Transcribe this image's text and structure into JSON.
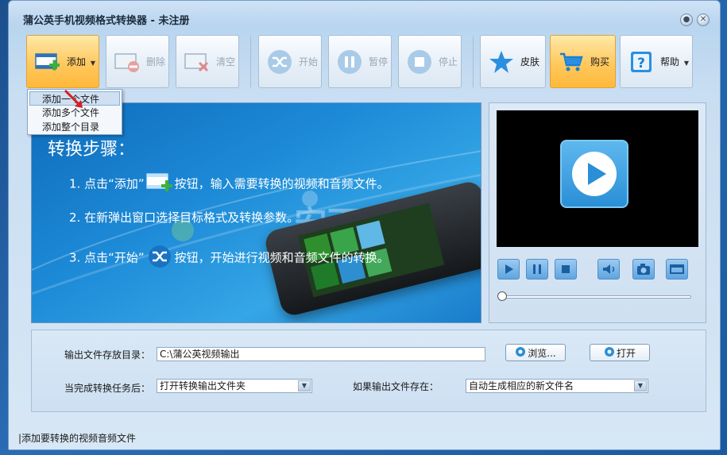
{
  "window": {
    "title": "蒲公英手机视频格式转换器 - 未注册",
    "min_glyph": "●",
    "close_glyph": "✕"
  },
  "toolbar": {
    "add_label": "添加",
    "delete_label": "删除",
    "clear_label": "清空",
    "start_label": "开始",
    "pause_label": "暂停",
    "stop_label": "停止",
    "skin_label": "皮肤",
    "buy_label": "购买",
    "help_label": "帮助"
  },
  "add_menu": {
    "items": [
      "添加一个文件",
      "添加多个文件",
      "添加整个目录"
    ]
  },
  "banner": {
    "title": "转换步骤：",
    "step1_a": "1. 点击“添加”",
    "step1_b": "按钮，输入需要转换的视频和音频文件。",
    "step2": "2. 在新弹出窗口选择目标格式及转换参数。",
    "step3_a": "3. 点击“开始”",
    "step3_b": "按钮，开始进行视频和音频文件的转换。",
    "watermark": "安下载"
  },
  "player": {
    "progress": 0
  },
  "settings": {
    "output_dir_label": "输出文件存放目录：",
    "output_dir_value": "C:\\蒲公英视频输出",
    "browse_label": "浏览...",
    "open_label": "打开",
    "after_done_label": "当完成转换任务后：",
    "after_done_value": "打开转换输出文件夹",
    "if_exists_label": "如果输出文件存在：",
    "if_exists_value": "自动生成相应的新文件名"
  },
  "status": {
    "text": "|添加要转换的视频音频文件"
  },
  "colors": {
    "accent_orange": "#ffc85e",
    "banner_blue": "#1d8ad7",
    "window_bg": "#c9def2"
  }
}
